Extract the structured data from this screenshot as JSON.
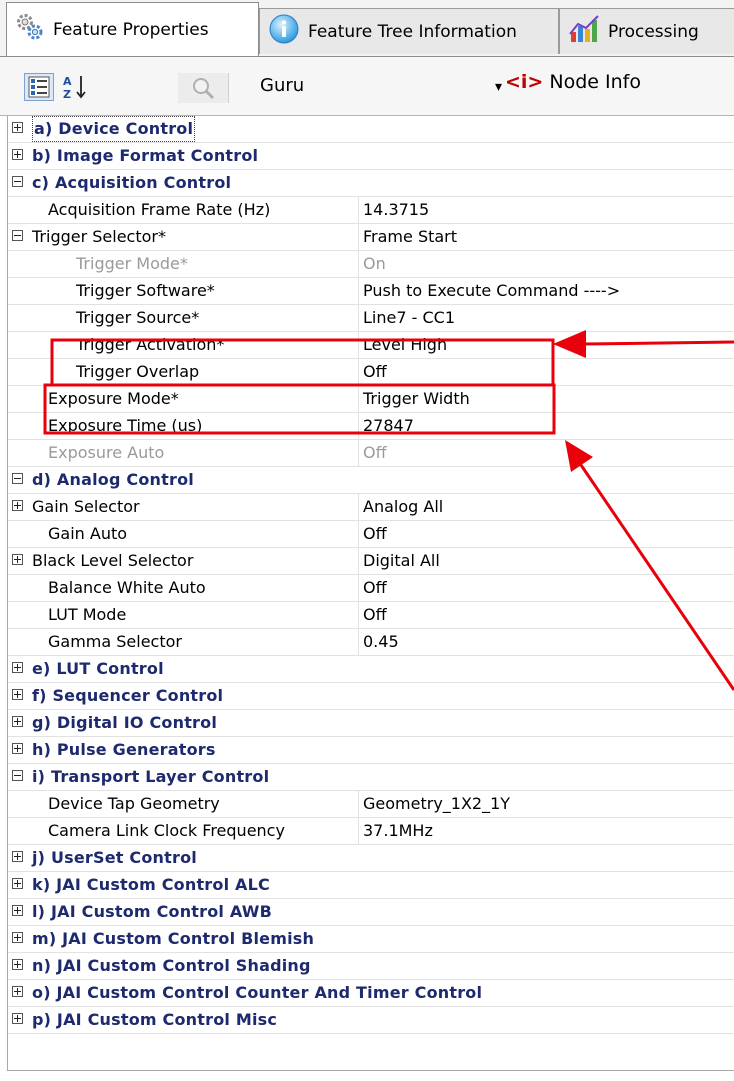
{
  "tabs": [
    {
      "label": "Feature Properties",
      "icon": "gear-icon",
      "active": true
    },
    {
      "label": "Feature Tree Information",
      "icon": "info-icon",
      "active": false
    },
    {
      "label": "Processing",
      "icon": "chart-icon",
      "active": false
    }
  ],
  "toolbar": {
    "categorized_icon": "categorized-view-icon",
    "sort_icon": "sort-az-icon",
    "search_icon": "magnifier-icon",
    "visibility": "Guru",
    "node_info_tag": "<i>",
    "node_info_label": "Node Info"
  },
  "tree": [
    {
      "kind": "cat",
      "label": "a) Device Control",
      "expander": "plus",
      "indent": 0,
      "focused": true
    },
    {
      "kind": "cat",
      "label": "b) Image Format Control",
      "expander": "plus",
      "indent": 0
    },
    {
      "kind": "cat",
      "label": "c) Acquisition Control",
      "expander": "minus",
      "indent": 0
    },
    {
      "kind": "prop",
      "label": "Acquisition Frame Rate (Hz)",
      "value": "14.3715",
      "indent": 1
    },
    {
      "kind": "prop",
      "label": "Trigger Selector*",
      "value": "Frame Start",
      "expander": "minus",
      "indent": 0
    },
    {
      "kind": "prop",
      "label": "Trigger Mode*",
      "value": "On",
      "indent": 2,
      "disabled": true
    },
    {
      "kind": "prop",
      "label": "Trigger Software*",
      "value": "Push to Execute Command ---->",
      "indent": 2
    },
    {
      "kind": "prop",
      "label": "Trigger Source*",
      "value": "Line7 - CC1",
      "indent": 2
    },
    {
      "kind": "prop",
      "label": "Trigger Activation*",
      "value": "Level High",
      "indent": 2
    },
    {
      "kind": "prop",
      "label": "Trigger Overlap",
      "value": "Off",
      "indent": 2
    },
    {
      "kind": "prop",
      "label": "Exposure Mode*",
      "value": "Trigger Width",
      "indent": 1
    },
    {
      "kind": "prop",
      "label": "Exposure Time (us)",
      "value": "27847",
      "indent": 1
    },
    {
      "kind": "prop",
      "label": "Exposure Auto",
      "value": "Off",
      "indent": 1,
      "disabled": true
    },
    {
      "kind": "cat",
      "label": "d) Analog Control",
      "expander": "minus",
      "indent": 0
    },
    {
      "kind": "prop",
      "label": "Gain Selector",
      "value": "Analog All",
      "expander": "plus",
      "indent": 0
    },
    {
      "kind": "prop",
      "label": "Gain Auto",
      "value": "Off",
      "indent": 1
    },
    {
      "kind": "prop",
      "label": "Black Level Selector",
      "value": "Digital All",
      "expander": "plus",
      "indent": 0
    },
    {
      "kind": "prop",
      "label": "Balance White Auto",
      "value": "Off",
      "indent": 1
    },
    {
      "kind": "prop",
      "label": "LUT Mode",
      "value": "Off",
      "indent": 1
    },
    {
      "kind": "prop",
      "label": "Gamma Selector",
      "value": "0.45",
      "indent": 1
    },
    {
      "kind": "cat",
      "label": "e) LUT Control",
      "expander": "plus",
      "indent": 0
    },
    {
      "kind": "cat",
      "label": "f) Sequencer Control",
      "expander": "plus",
      "indent": 0
    },
    {
      "kind": "cat",
      "label": "g) Digital IO Control",
      "expander": "plus",
      "indent": 0
    },
    {
      "kind": "cat",
      "label": "h) Pulse Generators",
      "expander": "plus",
      "indent": 0
    },
    {
      "kind": "cat",
      "label": "i) Transport Layer Control",
      "expander": "minus",
      "indent": 0
    },
    {
      "kind": "prop",
      "label": "Device Tap Geometry",
      "value": "Geometry_1X2_1Y",
      "indent": 1
    },
    {
      "kind": "prop",
      "label": "Camera Link Clock Frequency",
      "value": "37.1MHz",
      "indent": 1
    },
    {
      "kind": "cat",
      "label": "j) UserSet Control",
      "expander": "plus",
      "indent": 0
    },
    {
      "kind": "cat",
      "label": "k) JAI Custom Control ALC",
      "expander": "plus",
      "indent": 0
    },
    {
      "kind": "cat",
      "label": "l) JAI Custom Control AWB",
      "expander": "plus",
      "indent": 0
    },
    {
      "kind": "cat",
      "label": "m) JAI Custom Control Blemish",
      "expander": "plus",
      "indent": 0
    },
    {
      "kind": "cat",
      "label": "n) JAI Custom Control Shading",
      "expander": "plus",
      "indent": 0
    },
    {
      "kind": "cat",
      "label": "o) JAI Custom Control Counter And Timer Control",
      "expander": "plus",
      "indent": 0
    },
    {
      "kind": "cat",
      "label": "p) JAI Custom Control Misc",
      "expander": "plus",
      "indent": 0
    }
  ],
  "annotation_color": "#e8000b"
}
